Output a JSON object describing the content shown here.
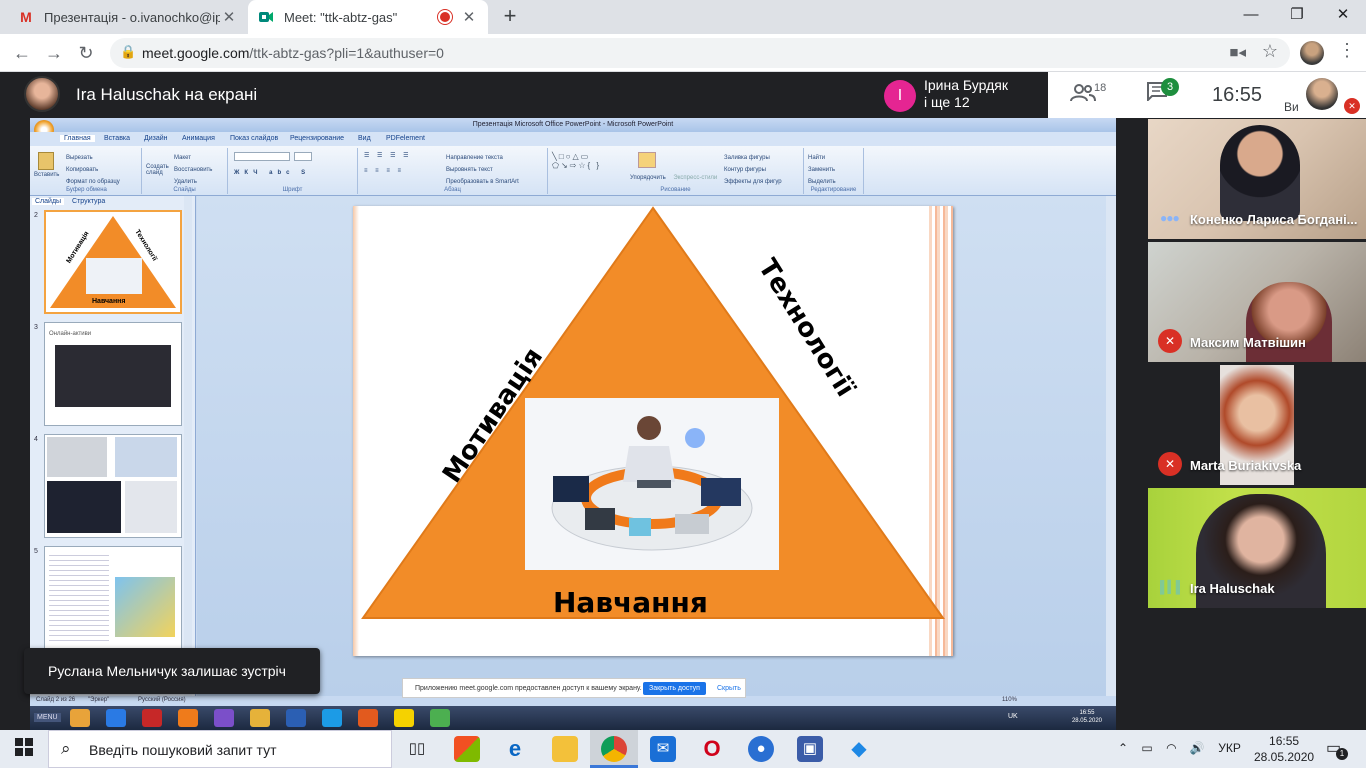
{
  "browser": {
    "tabs": [
      {
        "title": "Презентація - o.ivanochko@ippo",
        "icon": "gmail-icon"
      },
      {
        "title": "Meet: \"ttk-abtz-gas\"",
        "icon": "meet-icon",
        "recording": true
      }
    ],
    "url_host": "meet.google.com",
    "url_path": "/ttk-abtz-gas?pli=1&authuser=0",
    "window_controls": {
      "minimize": "—",
      "maximize": "❐",
      "close": "✕"
    }
  },
  "meet": {
    "presenter_label": "Ira Haluschak на екрані",
    "joiner_initial": "І",
    "joiner_name": "Ірина Бурдяк",
    "joiner_more": "і ще 12",
    "people_count": "18",
    "chat_count": "3",
    "clock": "16:55",
    "you_label": "Ви",
    "accent_color": "#1e8e3e"
  },
  "participants": [
    {
      "name": "Коненко Лариса Богдані...",
      "status": "speaking"
    },
    {
      "name": "Максим Матвішин",
      "status": "muted"
    },
    {
      "name": "Marta Buriakivska",
      "status": "muted"
    },
    {
      "name": "Ira Haluschak",
      "status": "speaking"
    }
  ],
  "toast": "Руслана Мельничук залишає зустріч",
  "shared_screen": {
    "window_title": "Презентація Microsoft Office PowerPoint - Microsoft PowerPoint",
    "ribbon_tabs": [
      "Главная",
      "Вставка",
      "Дизайн",
      "Анимация",
      "Показ слайдов",
      "Рецензирование",
      "Вид",
      "PDFelement"
    ],
    "ribbon_groups": [
      "Буфер обмена",
      "Слайды",
      "Шрифт",
      "Абзац",
      "Рисование",
      "Редактирование"
    ],
    "clipboard_items": [
      "Вырезать",
      "Копировать",
      "Формат по образцу"
    ],
    "insert_label": "Вставить",
    "slides_items": [
      "Макет",
      "Восстановить",
      "Удалить"
    ],
    "new_slide_label": "Создать слайд",
    "paragraph_items": [
      "Направление текста",
      "Выровнять текст",
      "Преобразовать в SmartArt"
    ],
    "drawing_items": [
      "Упорядочить",
      "Экспресс-стили",
      "Заливка фигуры",
      "Контур фигуры",
      "Эффекты для фигур"
    ],
    "editing_items": [
      "Найти",
      "Заменить",
      "Выделить"
    ],
    "pane_tabs": [
      "Слайды",
      "Структура"
    ],
    "thumb_numbers": [
      "2",
      "3",
      "4",
      "5"
    ],
    "thumb2_text": {
      "left": "Мотивація",
      "right": "Технології",
      "bottom": "Навчання"
    },
    "thumb3_title": "Онлайн-активи",
    "slide": {
      "left_label": "Мотивація",
      "right_label": "Технології",
      "bottom_label": "Навчання",
      "triangle_color": "#f28c28"
    },
    "status_bar": {
      "slide_info": "Слайд 2 из 26",
      "theme": "\"Эркер\"",
      "language": "Русский (Россия)",
      "zoom": "110%"
    },
    "share_notice": "Приложению meet.google.com предоставлен доступ к вашему экрану.",
    "share_stop": "Закрыть доступ",
    "share_hide": "Скрыть",
    "xp_start": "MENU",
    "xp_lang": "UK",
    "xp_time": "16:55",
    "xp_date": "28.05.2020"
  },
  "windows": {
    "search_placeholder": "Введіть пошуковий запит тут",
    "lang": "УКР",
    "time": "16:55",
    "date": "28.05.2020",
    "notifications": "1"
  }
}
